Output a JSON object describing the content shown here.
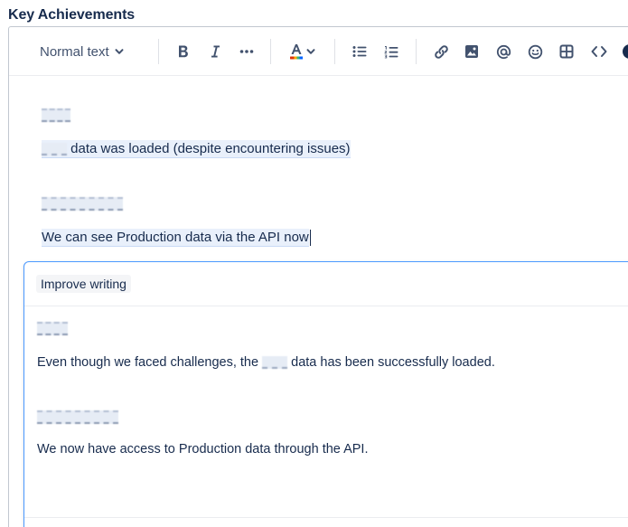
{
  "field": {
    "label": "Key Achievements"
  },
  "toolbar": {
    "text_style": "Normal text",
    "buttons": [
      {
        "name": "bold-button",
        "icon": "bold-icon"
      },
      {
        "name": "italic-button",
        "icon": "italic-icon"
      },
      {
        "name": "more-formatting-button",
        "icon": "more-icon"
      },
      {
        "name": "text-color-button",
        "icon": "text-color-icon"
      },
      {
        "name": "bullet-list-button",
        "icon": "bullet-list-icon"
      },
      {
        "name": "numbered-list-button",
        "icon": "numbered-list-icon"
      },
      {
        "name": "link-button",
        "icon": "link-icon"
      },
      {
        "name": "image-button",
        "icon": "image-icon"
      },
      {
        "name": "mention-button",
        "icon": "mention-icon"
      },
      {
        "name": "emoji-button",
        "icon": "emoji-icon"
      },
      {
        "name": "table-button",
        "icon": "table-icon"
      },
      {
        "name": "code-button",
        "icon": "code-icon"
      }
    ]
  },
  "editor": {
    "paragraph_1": "data was loaded (despite encountering issues)",
    "paragraph_2": "We can see Production data via the API now"
  },
  "ai_panel": {
    "tag": "Improve writing",
    "paragraph_1_before": "Even though we faced challenges, the",
    "paragraph_1_after": "data has been successfully loaded.",
    "paragraph_2": "We now have access to Production data through the API."
  },
  "colors": {
    "text": "#172b4d",
    "icon": "#42526e",
    "focus_border": "#4c9aff",
    "selection": "#e9f0fb",
    "text_color_swatch": "#de350b"
  }
}
